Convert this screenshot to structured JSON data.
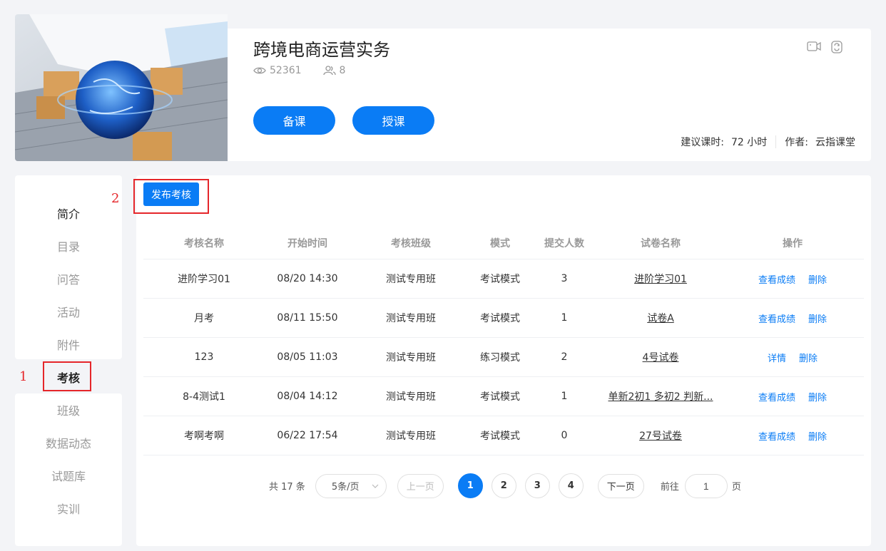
{
  "course": {
    "title": "跨境电商运营实务",
    "views": "52361",
    "members": "8",
    "prepare_label": "备课",
    "teach_label": "授课",
    "hours_label": "建议课时:",
    "hours_value": "72 小时",
    "author_label": "作者:",
    "author_value": "云指课堂"
  },
  "icons": {
    "eye": "eye-icon",
    "users": "users-icon",
    "video": "video-icon",
    "share": "share-icon"
  },
  "sidebar": {
    "items": [
      {
        "label": "简介"
      },
      {
        "label": "目录"
      },
      {
        "label": "问答"
      },
      {
        "label": "活动"
      },
      {
        "label": "附件"
      },
      {
        "label": "考核"
      },
      {
        "label": "班级"
      },
      {
        "label": "数据动态"
      },
      {
        "label": "试题库"
      },
      {
        "label": "实训"
      }
    ],
    "active": "考核"
  },
  "annotations": {
    "one": "1",
    "two": "2"
  },
  "main": {
    "publish_label": "发布考核",
    "columns": [
      "考核名称",
      "开始时间",
      "考核班级",
      "模式",
      "提交人数",
      "试卷名称",
      "操作"
    ],
    "rows": [
      {
        "name": "进阶学习01",
        "start": "08/20 14:30",
        "class": "测试专用班",
        "mode": "考试模式",
        "count": "3",
        "paper": "进阶学习01",
        "op1": "查看成绩",
        "op2": "删除"
      },
      {
        "name": "月考",
        "start": "08/11 15:50",
        "class": "测试专用班",
        "mode": "考试模式",
        "count": "1",
        "paper": "试卷A",
        "op1": "查看成绩",
        "op2": "删除"
      },
      {
        "name": "123",
        "start": "08/05 11:03",
        "class": "测试专用班",
        "mode": "练习模式",
        "count": "2",
        "paper": "4号试卷",
        "op1": "详情",
        "op2": "删除"
      },
      {
        "name": "8-4测试1",
        "start": "08/04 14:12",
        "class": "测试专用班",
        "mode": "考试模式",
        "count": "1",
        "paper": "单新2初1 多初2 判新...",
        "op1": "查看成绩",
        "op2": "删除"
      },
      {
        "name": "考啊考啊",
        "start": "06/22 17:54",
        "class": "测试专用班",
        "mode": "考试模式",
        "count": "0",
        "paper": "27号试卷",
        "op1": "查看成绩",
        "op2": "删除"
      }
    ]
  },
  "pagination": {
    "total_text": "共 17 条",
    "page_size": "5条/页",
    "prev": "上一页",
    "pages": [
      "1",
      "2",
      "3",
      "4"
    ],
    "current": "1",
    "next": "下一页",
    "goto_label": "前往",
    "goto_value": "1",
    "page_suffix": "页"
  },
  "colors": {
    "primary": "#0a7cf5",
    "highlight": "#e5262a"
  }
}
